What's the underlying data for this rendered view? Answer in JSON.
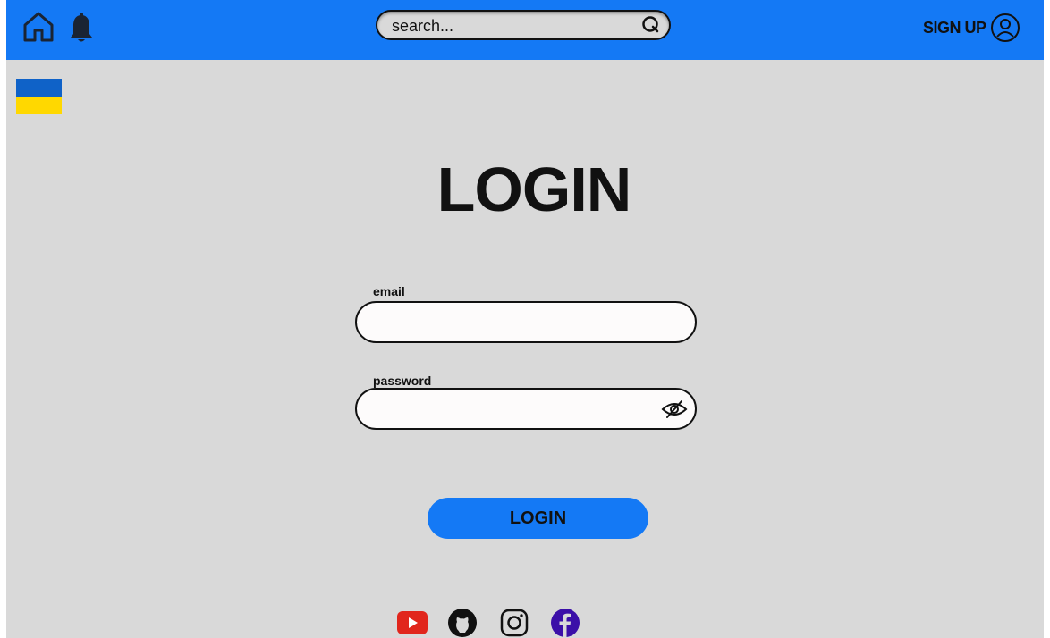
{
  "topbar": {
    "home_icon": "home-icon",
    "bell_icon": "bell-icon",
    "search": {
      "placeholder": "search...",
      "value": "",
      "icon": "search-icon"
    },
    "signup": {
      "label": "SIGN UP",
      "icon": "user-circle-icon"
    },
    "colors": {
      "bar": "#1479f5"
    }
  },
  "language": {
    "flag_icon": "ukraine-flag-icon",
    "colors": [
      "#0f62c8",
      "#ffd800"
    ]
  },
  "login": {
    "title": "LOGIN",
    "email_label": "email",
    "email_value": "",
    "password_label": "password",
    "password_value": "",
    "toggle_icon": "eye-off-icon",
    "submit_label": "LOGIN"
  },
  "footer": {
    "social_icons": [
      "youtube-icon",
      "github-icon",
      "instagram-icon",
      "facebook-icon"
    ]
  }
}
